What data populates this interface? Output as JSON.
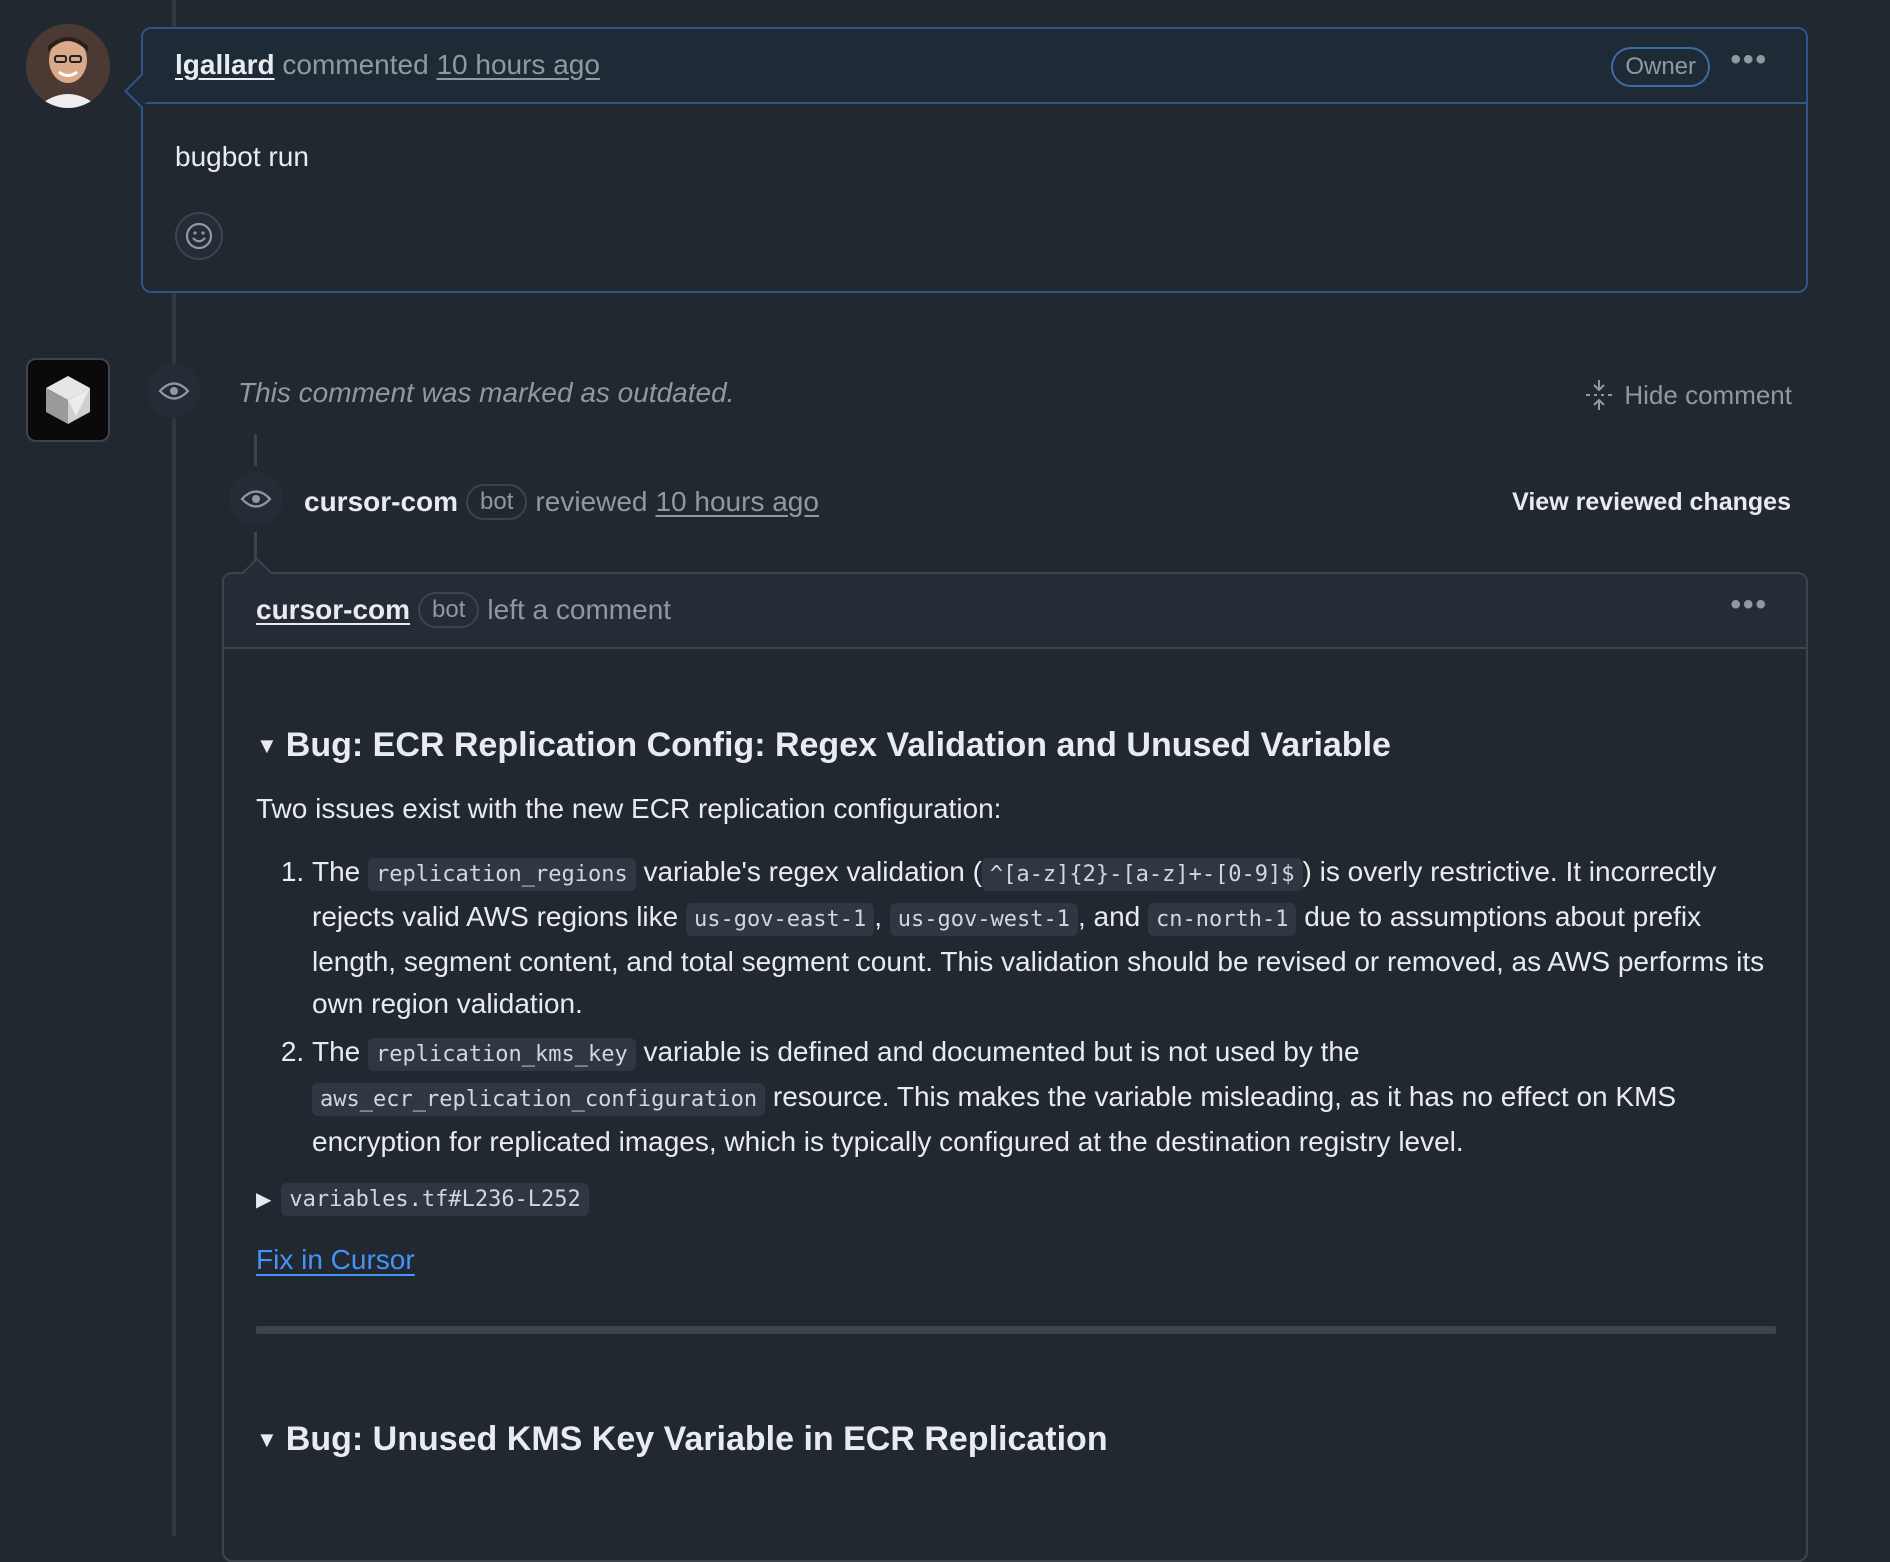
{
  "comment1": {
    "author": "lgallard",
    "action": "commented",
    "time": "10 hours ago",
    "badge": "Owner",
    "body": "bugbot run"
  },
  "outdated": {
    "message": "This comment was marked as outdated.",
    "hide_label": "Hide comment"
  },
  "review": {
    "author": "cursor-com",
    "bot_badge": "bot",
    "action": "reviewed",
    "time": "10 hours ago",
    "view_changes": "View reviewed changes"
  },
  "comment2": {
    "author": "cursor-com",
    "bot_badge": "bot",
    "action": "left a comment",
    "bug1": {
      "title": "Bug: ECR Replication Config: Regex Validation and Unused Variable",
      "intro": "Two issues exist with the new ECR replication configuration:",
      "item1": {
        "t1": "The ",
        "c1": "replication_regions",
        "t2": " variable's regex validation (",
        "c2": "^[a-z]{2}-[a-z]+-[0-9]$",
        "t3": ") is overly restrictive. It incorrectly rejects valid AWS regions like ",
        "c3": "us-gov-east-1",
        "t4": ", ",
        "c4": "us-gov-west-1",
        "t5": ", and ",
        "c5": "cn-north-1",
        "t6": " due to assumptions about prefix length, segment content, and total segment count. This validation should be revised or removed, as AWS performs its own region validation."
      },
      "item2": {
        "t1": "The ",
        "c1": "replication_kms_key",
        "t2": " variable is defined and documented but is not used by the ",
        "c2": "aws_ecr_replication_configuration",
        "t3": " resource. This makes the variable misleading, as it has no effect on KMS encryption for replicated images, which is typically configured at the destination registry level."
      },
      "details": "variables.tf#L236-L252",
      "fix_link": "Fix in Cursor"
    },
    "bug2": {
      "title": "Bug: Unused KMS Key Variable in ECR Replication"
    }
  }
}
